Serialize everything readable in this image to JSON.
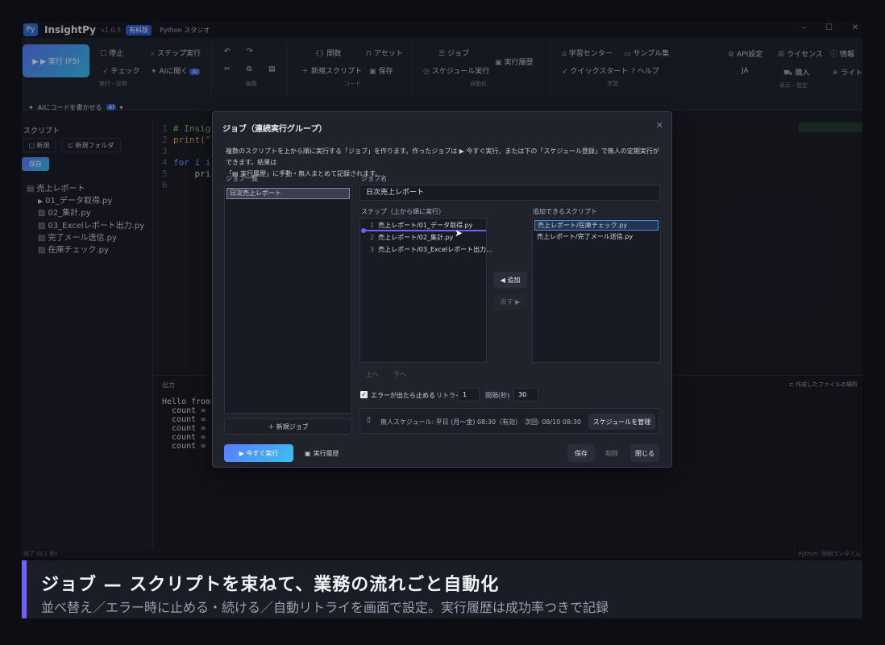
{
  "titlebar": {
    "appname": "InsightPy",
    "version": "v1.0.5",
    "edition": "有料版",
    "subtitle": "Python スタジオ"
  },
  "ribbon": {
    "run": "▶ ▶ 実行 (F5)",
    "stop": "停止",
    "check": "チェック",
    "step": "ステップ実行",
    "ai_open": "AIに聞く",
    "ai_badge": "AI",
    "group_run": "実行・診断",
    "group_edit": "編集",
    "func": "関数",
    "asset": "アセット",
    "new_script": "新規スクリプト",
    "save": "保存",
    "group_code": "コード",
    "job": "ジョブ",
    "schedule_run": "スケジュール実行",
    "run_history": "実行履歴",
    "group_auto": "自動化",
    "learn_center": "学習センター",
    "samples": "サンプル集",
    "quickstart": "クイックスタート",
    "help": "ヘルプ",
    "group_learn": "学習",
    "api_settings": "API設定",
    "license": "ライセンス",
    "info": "情報",
    "lang": "JA",
    "buy": "購入",
    "light": "ライト",
    "group_view": "表示・設定"
  },
  "promptbar": {
    "text": "AIにコードを書かせる",
    "badge": "AI",
    "chev": "▾"
  },
  "sidebar": {
    "header": "スクリプト",
    "new": "新規",
    "new_folder": "新規フォルダ",
    "save": "保存",
    "folder": "売上レポート",
    "files": [
      "01_データ取得.py",
      "02_集計.py",
      "03_Excelレポート出力.py",
      "完了メール送信.py",
      "在庫チェック.py"
    ]
  },
  "editor": {
    "lines": [
      "# Insig",
      "print(\"",
      "",
      "for i i",
      "    pri",
      ""
    ]
  },
  "output": {
    "header": "出力",
    "open_location": "作成したファイルの場所",
    "lines": [
      "Hello from",
      "  count = :",
      "  count = :",
      "  count = :",
      "  count = :",
      "  count = :"
    ]
  },
  "statusbar": {
    "left": "完了 (0.1 秒)",
    "right": "Python: 同梱ランタイム"
  },
  "dialog": {
    "title": "ジョブ（連続実行グループ）",
    "desc1": "複数のスクリプトを上から順に実行する「ジョブ」を作ります。作ったジョブは ▶ 今すぐ実行、または下の「スケジュール登録」で無人の定期実行ができます。結果は",
    "desc2": "「▤ 実行履歴」に手動・無人まとめて記録されます。",
    "job_list_label": "ジョブ一覧",
    "jobs": [
      "日次売上レポート"
    ],
    "job_name_label": "ジョブ名",
    "job_name": "日次売上レポート",
    "steps_label": "ステップ（上から順に実行）",
    "steps": [
      {
        "no": "1",
        "name": "売上レポート/01_データ取得.py"
      },
      {
        "no": "2",
        "name": "売上レポート/02_集計.py"
      },
      {
        "no": "3",
        "name": "売上レポート/03_Excelレポート出力..."
      }
    ],
    "avail_label": "追加できるスクリプト",
    "avail": [
      "売上レポート/在庫チェック.py",
      "売上レポート/完了メール送信.py"
    ],
    "add": "◀ 追加",
    "back": "戻す ▶",
    "up": "上へ",
    "down": "下へ",
    "stop_on_error": "エラーが出たら止める",
    "retry_label": "リトライ",
    "retry": "1",
    "interval_label": "間隔(秒)",
    "interval": "30",
    "schedule": "無人スケジュール: 平日 (月〜金) 08:30（有効）　次回: 08/10 08:30",
    "manage_schedule": "スケジュールを管理",
    "new_job": "＋ 新規ジョブ",
    "run_now": "▶ 今すぐ実行",
    "history": "実行履歴",
    "save": "保存",
    "delete": "削除",
    "close": "閉じる"
  },
  "banner": {
    "heading": "ジョブ — スクリプトを束ねて、業務の流れごと自動化",
    "sub": "並べ替え／エラー時に止める・続ける／自動リトライを画面で設定。実行履歴は成功率つきで記録"
  },
  "colors": {
    "accent": "#5b7cff",
    "gradient_end": "#38c0f0",
    "bg": "#1b1d26",
    "banner_bar": "#6a63ff"
  }
}
